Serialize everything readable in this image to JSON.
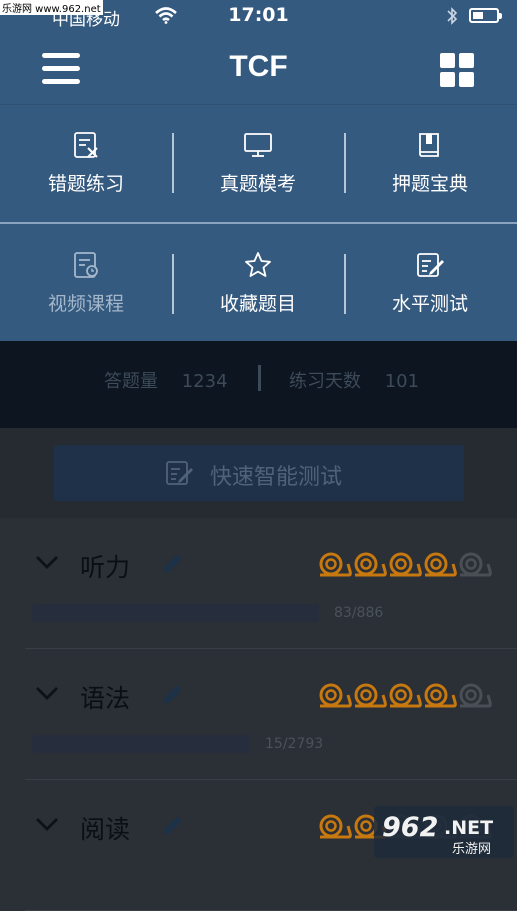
{
  "status_bar": {
    "carrier": "中国移动",
    "site_watermark": "乐游网 www.962.net",
    "time": "17:01"
  },
  "nav": {
    "title": "TCF",
    "menu_icon": "hamburger-menu-icon",
    "grid_icon": "grid-apps-icon"
  },
  "menu_items": [
    {
      "label": "错题练习",
      "icon": "wrong-question-icon"
    },
    {
      "label": "真题模考",
      "icon": "monitor-icon"
    },
    {
      "label": "押题宝典",
      "icon": "book-icon"
    },
    {
      "label": "视频课程",
      "icon": "video-course-icon"
    },
    {
      "label": "收藏题目",
      "icon": "star-icon"
    },
    {
      "label": "水平测试",
      "icon": "edit-test-icon"
    }
  ],
  "stats": {
    "answered_label": "答题量",
    "answered_value": "1234",
    "days_label": "练习天数",
    "days_value": "101"
  },
  "quick_test": {
    "label": "快速智能测试",
    "icon": "quick-test-icon"
  },
  "sections": [
    {
      "title": "听力",
      "count": "83/886",
      "progress": 0.094,
      "snails_filled": 4,
      "snails_total": 5
    },
    {
      "title": "语法",
      "count": "15/2793",
      "progress": 0.005,
      "snails_filled": 4,
      "snails_total": 5
    },
    {
      "title": "阅读",
      "count": "",
      "progress": 0,
      "snails_filled": 2,
      "snails_total": 5
    }
  ],
  "colors": {
    "header_blue": "#355a80",
    "snail_orange": "#c7780e",
    "snail_gray": "#4a4e55"
  },
  "watermark": {
    "brand_number": "962",
    "brand_suffix": ".NET",
    "brand_cn": "乐游网"
  }
}
